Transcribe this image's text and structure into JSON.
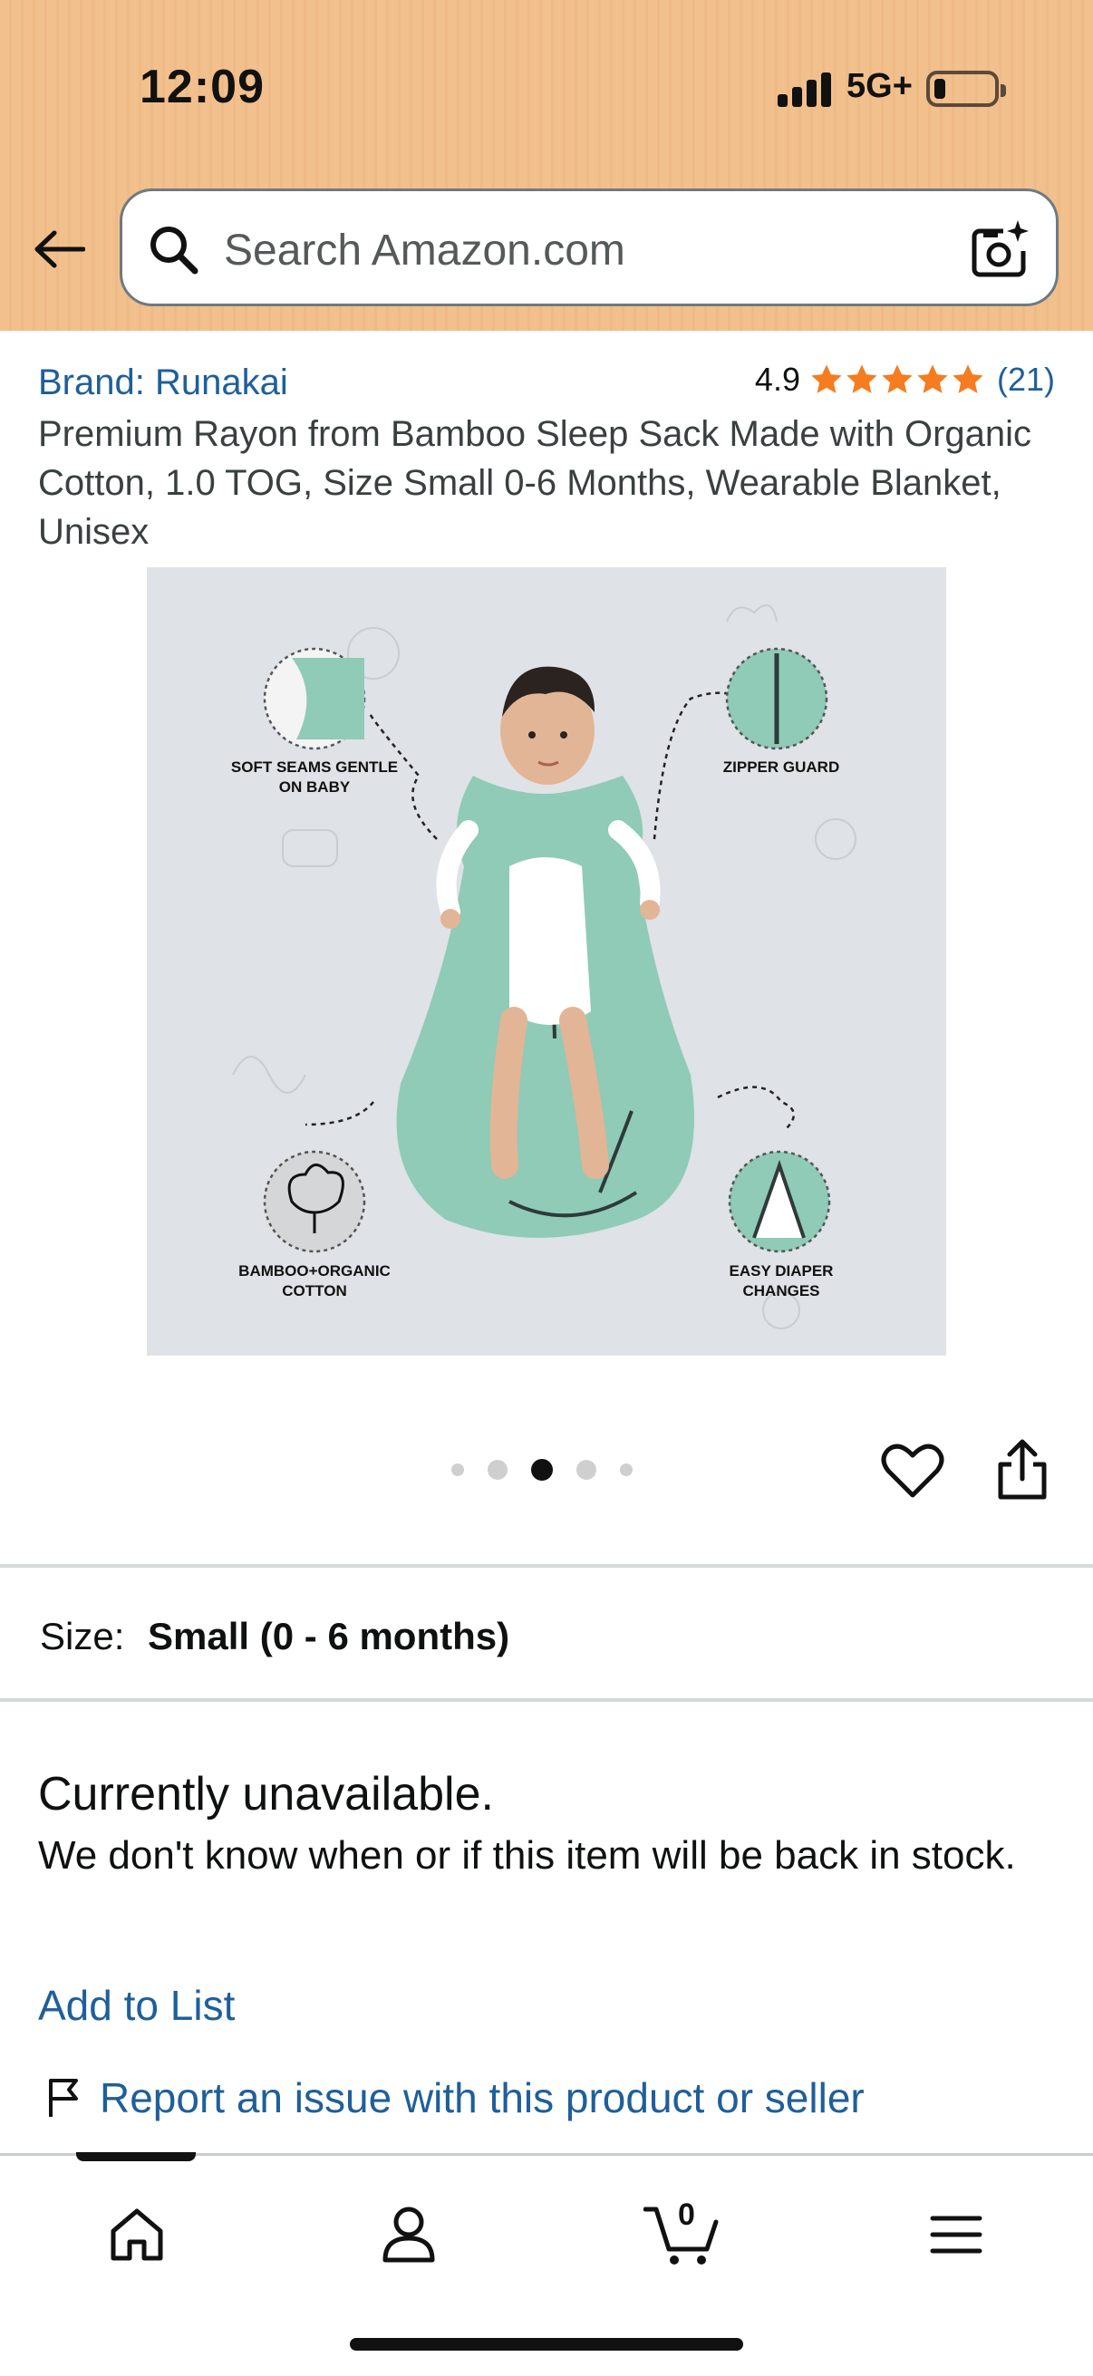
{
  "status_bar": {
    "time": "12:09",
    "network": "5G+",
    "battery_level": 0.15
  },
  "search": {
    "placeholder": "Search Amazon.com",
    "icons": [
      "back-arrow-icon",
      "search-icon",
      "camera-search-icon"
    ]
  },
  "product": {
    "brand": "Brand: Runakai",
    "rating_value": "4.9",
    "rating_stars": 5,
    "rating_count": "(21)",
    "title": "Premium Rayon from Bamboo Sleep Sack Made with Organic Cotton, 1.0 TOG, Size Small 0-6 Months, Wearable Blanket, Unisex",
    "image_callouts": {
      "top_left": "SOFT SEAMS GENTLE\nON BABY",
      "top_right": "ZIPPER GUARD",
      "bottom_left": "BAMBOO+ORGANIC\nCOTTON",
      "bottom_right": "EASY DIAPER\nCHANGES"
    },
    "carousel": {
      "total": 5,
      "active_index": 2
    }
  },
  "size": {
    "label": "Size:",
    "value": "Small (0 - 6 months)"
  },
  "availability": {
    "status": "Currently unavailable.",
    "note": "We don't know when or if this item will be back in stock."
  },
  "actions": {
    "add_to_list": "Add to List",
    "report_issue": "Report an issue with this product or seller"
  },
  "bottom_nav": {
    "items": [
      "home-icon",
      "account-icon",
      "cart-icon",
      "menu-icon"
    ],
    "cart_count": "0"
  },
  "colors": {
    "header_bg": "#f2c08d",
    "link": "#1f5f9a",
    "star": "#f57c1f",
    "product_bg": "#dfe2e6",
    "sleep_sack": "#8fcbb6"
  }
}
